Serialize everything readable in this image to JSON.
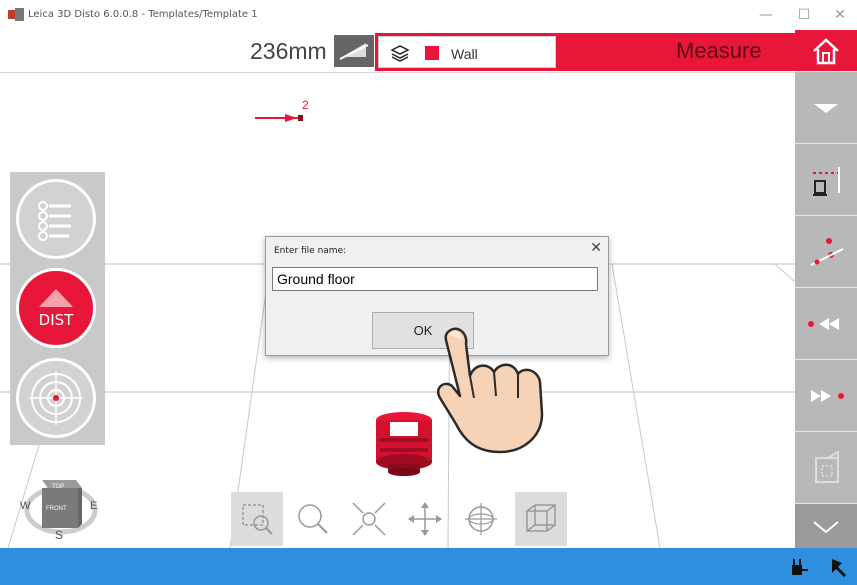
{
  "window": {
    "title": "Leica 3D Disto 6.0.0.8 - Templates/Template 1",
    "minimize_glyph": "—",
    "maximize_glyph": "☐",
    "close_glyph": "✕"
  },
  "topbar": {
    "measurement": "236mm",
    "layer_label": "Wall",
    "layer_color": "#e8173a",
    "mode": "Measure"
  },
  "canvas": {
    "point_label": "2"
  },
  "left_panel": {
    "dist_label": "DIST"
  },
  "compass": {
    "west": "W",
    "east": "E",
    "south": "S",
    "cube_top": "TOP",
    "cube_front": "FRONT"
  },
  "dialog": {
    "title": "Enter file name:",
    "close_glyph": "✕",
    "input_value": "Ground floor",
    "ok_label": "OK"
  },
  "colors": {
    "accent_red": "#e8173a",
    "status_blue": "#2d8fde",
    "panel_gray": "#c8c8c8"
  }
}
